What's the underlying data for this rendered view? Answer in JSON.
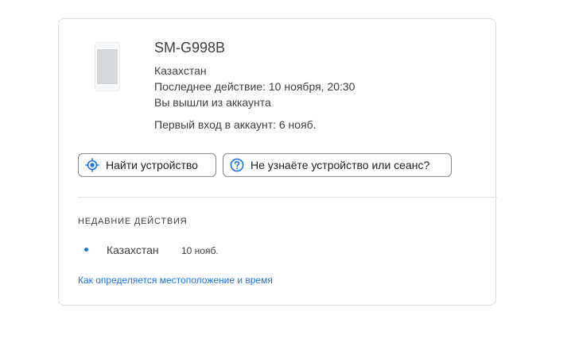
{
  "device": {
    "icon": "smartphone-icon",
    "name": "SM-G998B",
    "location": "Казахстан",
    "last_activity": "Последнее действие: 10 ноября, 20:30",
    "session_status": "Вы вышли из аккаунта",
    "first_sign_in": "Первый вход в аккаунт: 6 нояб."
  },
  "actions": {
    "find_device": {
      "label": "Найти устройство",
      "icon": "locate-icon"
    },
    "unrecognized": {
      "label": "Не узнаёте устройство или сеанс?",
      "icon": "help-circle-icon"
    }
  },
  "recent_activity": {
    "heading": "НЕДАВНИЕ ДЕЙСТВИЯ",
    "items": [
      {
        "place": "Казахстан",
        "date": "10 нояб."
      }
    ]
  },
  "help_link": "Как определяется местоположение и время",
  "colors": {
    "accent": "#1a73e8",
    "border": "#dadce0",
    "text": "#3c4043"
  }
}
